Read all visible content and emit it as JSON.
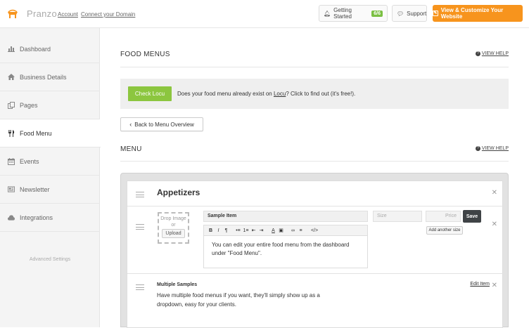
{
  "topbar": {
    "brand": "Pranzo",
    "links": [
      "Account",
      "Connect your Domain"
    ],
    "getting_started": "Getting Started",
    "progress": "6/6",
    "support": "Support",
    "cta": "View & Customize Your Website",
    "accent": "#f7941d"
  },
  "sidebar": {
    "items": [
      {
        "label": "Dashboard",
        "icon": "bar-chart-icon"
      },
      {
        "label": "Business Details",
        "icon": "home-icon"
      },
      {
        "label": "Pages",
        "icon": "pages-icon"
      },
      {
        "label": "Food Menu",
        "icon": "utensils-icon",
        "active": true
      },
      {
        "label": "Events",
        "icon": "calendar-icon"
      },
      {
        "label": "Newsletter",
        "icon": "newsletter-icon"
      },
      {
        "label": "Integrations",
        "icon": "cloud-icon"
      }
    ],
    "advanced": "Advanced Settings"
  },
  "main": {
    "title": "FOOD MENUS",
    "view_help": "VIEW HELP",
    "locu_button": "Check Locu",
    "locu_text_before": "Does your food menu already exist on ",
    "locu_link": "Locu",
    "locu_text_after": "? Click to find out (it's free!).",
    "back_button": "Back to Menu Overview",
    "menu_title": "MENU",
    "menu_help": "VIEW HELP"
  },
  "menu": {
    "category": "Appetizers",
    "new_item": {
      "drop_line1": "Drop Image",
      "drop_line2": "or",
      "upload": "Upload",
      "name_value": "Sample Item",
      "size_placeholder": "Size",
      "price_placeholder": "Price",
      "save": "Save",
      "add_size": "Add another size",
      "toolbar": [
        "B",
        "I",
        "¶",
        "•≡",
        "1≡",
        "⇤",
        "⇥",
        "A",
        "▣",
        "∞",
        "≡",
        "</>"
      ],
      "description": "You can edit your entire food menu from the dashboard under \"Food Menu\"."
    },
    "items": [
      {
        "title": "Multiple Samples",
        "description": "Have multiple food menus if you want, they'll simply show up as a dropdown, easy for your clients.",
        "edit": "Edit Item"
      }
    ]
  }
}
